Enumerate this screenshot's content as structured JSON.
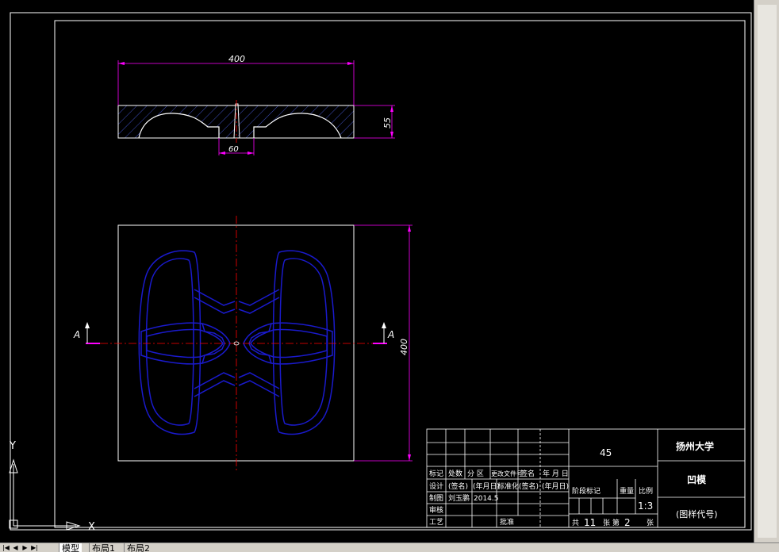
{
  "drawing": {
    "top_view": {
      "width_dim": "400",
      "height_dim": "55",
      "slot_dim": "60"
    },
    "plan_view": {
      "height_dim": "400",
      "section_label_left": "A",
      "section_label_right": "A"
    },
    "ucs": {
      "y_label": "Y",
      "x_label": "X"
    }
  },
  "title_block": {
    "headers": [
      "标记",
      "处数",
      "分 区",
      "更改文件号",
      "签名",
      "年 月 日"
    ],
    "design_label": "设计",
    "design_sign": "(签名)",
    "design_date": "(年月日)",
    "standard_label": "标准化",
    "standard_sign": "(签名)",
    "standard_date": "(年月日)",
    "drawn_label": "制图",
    "drawn_name": "刘玉鹏",
    "drawn_date": "2014.5",
    "review_label": "审核",
    "process_label": "工艺",
    "approve_label": "批准",
    "material": "45",
    "stage_label": "阶段标记",
    "weight_label": "重量",
    "scale_label": "比例",
    "scale_value": "1:3",
    "total_label": "共",
    "total_sheets": "11",
    "sheet_label": "张 第",
    "sheet_no": "2",
    "sheet_unit": "张",
    "school": "扬州大学",
    "part_name": "凹模",
    "drawing_code": "(图样代号)"
  },
  "tabs": [
    "模型",
    "布局1",
    "布局2"
  ],
  "colors": {
    "background": "#000000",
    "outline": "#ffffff",
    "dimension": "#ff00ff",
    "centerline": "#ff0000",
    "cavity": "#0000ff",
    "hatch": "#4050c0"
  }
}
